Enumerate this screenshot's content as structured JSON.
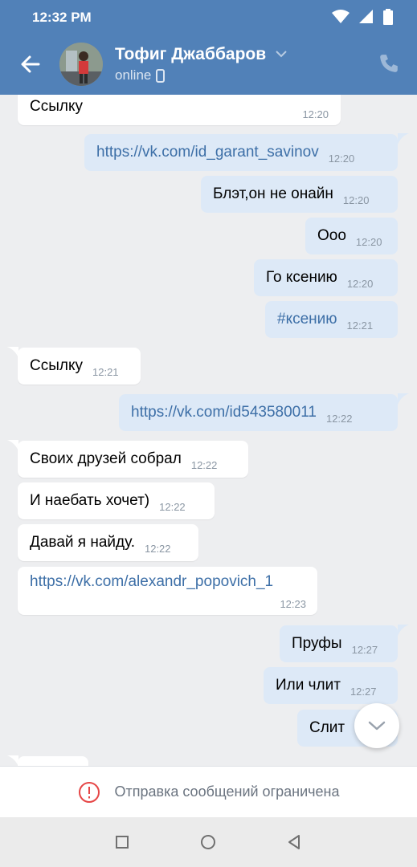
{
  "status_bar": {
    "time": "12:32 PM"
  },
  "header": {
    "contact_name": "Тофиг Джаббаров",
    "status": "online"
  },
  "messages": [
    {
      "dir": "in",
      "text": "Ссылку",
      "time": "12:20"
    },
    {
      "dir": "out",
      "text": "https://vk.com/id_garant_savinov",
      "time": "12:20",
      "link": true
    },
    {
      "dir": "out",
      "text": "Блэт,он не онайн",
      "time": "12:20"
    },
    {
      "dir": "out",
      "text": "Ооо",
      "time": "12:20"
    },
    {
      "dir": "out",
      "text": "Го ксению",
      "time": "12:20"
    },
    {
      "dir": "out",
      "text": "#ксению",
      "time": "12:21",
      "link": true
    },
    {
      "dir": "in",
      "text": "Ссылку",
      "time": "12:21"
    },
    {
      "dir": "out",
      "text": "https://vk.com/id543580011",
      "time": "12:22",
      "link": true
    },
    {
      "dir": "in",
      "text": "Своих друзей собрал",
      "time": "12:22"
    },
    {
      "dir": "in",
      "text": "И наебать хочет)",
      "time": "12:22"
    },
    {
      "dir": "in",
      "text": "Давай я найду.",
      "time": "12:22"
    },
    {
      "dir": "in",
      "text": "https://vk.com/alexandr_popovich_1",
      "time": "12:23",
      "link": true
    },
    {
      "dir": "out",
      "text": "Пруфы",
      "time": "12:27"
    },
    {
      "dir": "out",
      "text": "Или члит",
      "time": "12:27"
    },
    {
      "dir": "out",
      "text": "Слит",
      "time": ""
    }
  ],
  "restriction": {
    "text": "Отправка сообщений ограничена"
  },
  "icons": {
    "back": "arrow-left-icon",
    "dropdown": "chevron-down-icon",
    "device": "mobile-phone-icon",
    "call": "phone-icon",
    "scroll": "chevron-down-icon",
    "warning": "exclamation-circle-icon"
  },
  "colors": {
    "header": "#5181b8",
    "bubble_out": "#dde9f7",
    "bubble_in": "#ffffff",
    "link": "#3d6fa7",
    "warning": "#e64646"
  }
}
